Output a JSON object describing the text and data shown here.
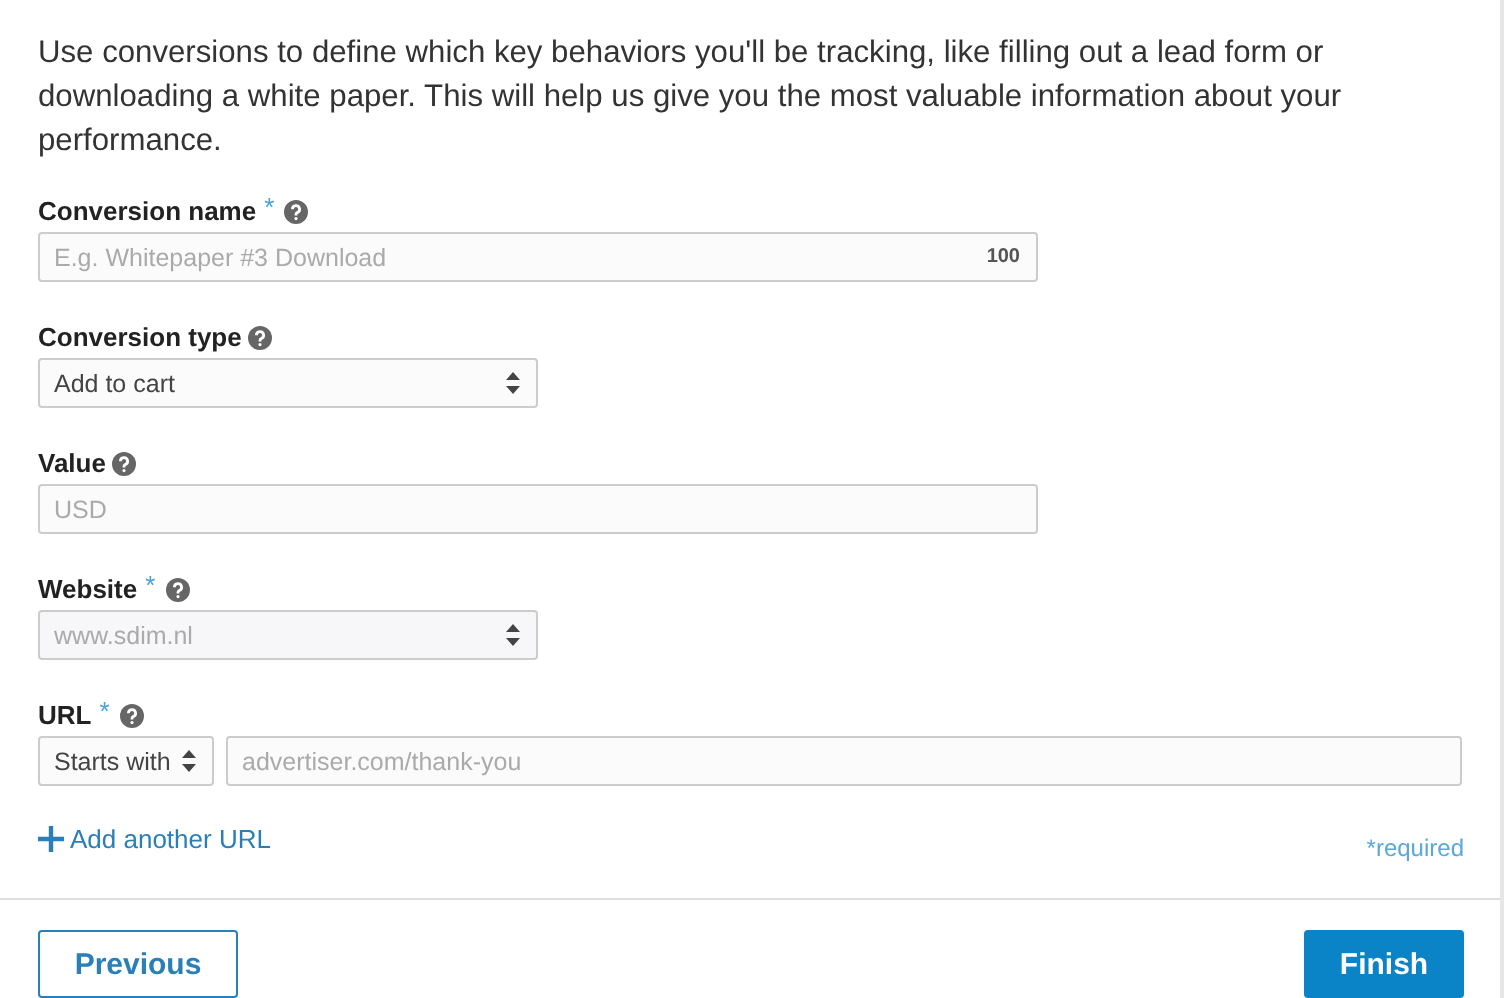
{
  "intro": "Use conversions to define which key behaviors you'll be tracking, like filling out a lead form or downloading a white paper. This will help us give you the most valuable information about your performance.",
  "fields": [
    {
      "label": "Conversion name",
      "required": true,
      "controls": [
        {
          "kind": "text",
          "placeholder": "E.g. Whitepaper #3 Download",
          "counter": "100"
        }
      ]
    },
    {
      "label": "Conversion type",
      "required": false,
      "controls": [
        {
          "kind": "select",
          "value": "Add to cart"
        }
      ]
    },
    {
      "label": "Value",
      "required": false,
      "controls": [
        {
          "kind": "text",
          "placeholder": "USD"
        }
      ]
    },
    {
      "label": "Website",
      "required": true,
      "controls": [
        {
          "kind": "select",
          "value": "www.sdim.nl",
          "disabled": true
        }
      ]
    },
    {
      "label": "URL",
      "required": true,
      "controls": [
        {
          "kind": "select",
          "value": "Starts with"
        },
        {
          "kind": "text",
          "placeholder": "advertiser.com/thank-you"
        }
      ]
    }
  ],
  "add_link": "Add another URL",
  "required_note": "*required",
  "required_mark": "*",
  "buttons": {
    "previous": "Previous",
    "finish": "Finish"
  }
}
